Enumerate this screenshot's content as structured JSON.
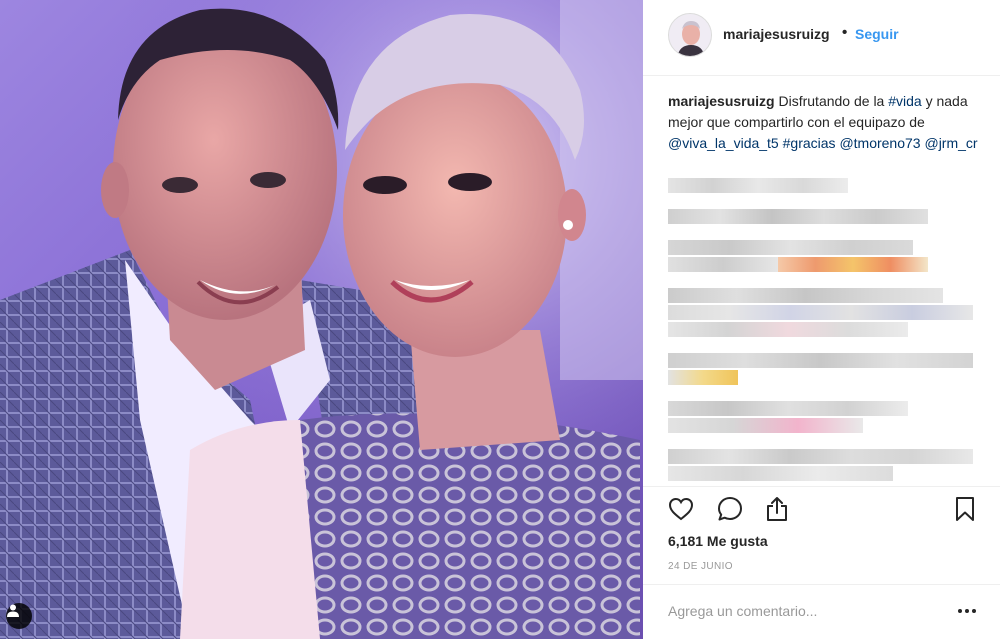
{
  "post": {
    "username": "mariajesusruizg",
    "dot": "•",
    "follow_label": "Seguir",
    "caption": {
      "username": "mariajesusruizg",
      "text_1": " Disfrutando de la ",
      "tag_vida": "#vida",
      "text_2": " y nada mejor que compartirlo con el equipazo de ",
      "tag_viva": "@viva_la_vida_t5",
      "text_3": " ",
      "tag_gracias": "#gracias",
      "text_4": " ",
      "tag_tmoreno": "@tmoreno73",
      "text_5": " ",
      "tag_jrm": "@jrm_cr"
    },
    "likes": "6,181 Me gusta",
    "date": "24 DE JUNIO",
    "comment_placeholder": "Agrega un comentario..."
  },
  "icons": {
    "like": "heart-icon",
    "comment": "comment-bubble-icon",
    "share": "share-icon",
    "save": "bookmark-icon",
    "more": "more-options-icon",
    "user_tag": "user-tag-icon"
  },
  "colors": {
    "link": "#3897f0",
    "hashtag": "#003569",
    "text": "#262626",
    "muted": "#999999",
    "border": "#efefef"
  }
}
